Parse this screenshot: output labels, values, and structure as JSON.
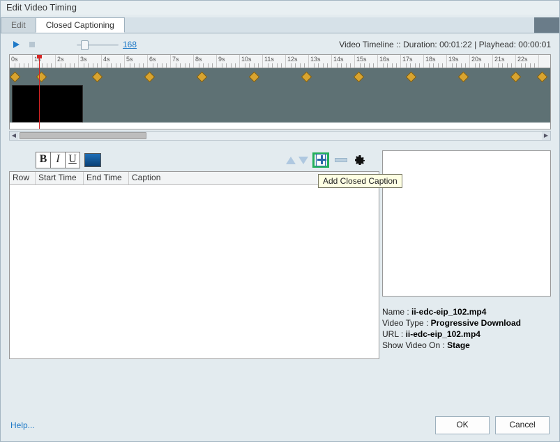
{
  "window": {
    "title": "Edit Video Timing"
  },
  "tabs": {
    "edit": "Edit",
    "cc": "Closed Captioning"
  },
  "controls": {
    "zoom": "168"
  },
  "timeline": {
    "info_prefix": "Video Timeline :: Duration: ",
    "duration": "00:01:22",
    "sep": "  |  Playhead: ",
    "playhead": "00:00:01",
    "tick_labels": [
      "0s",
      "1s",
      "2s",
      "3s",
      "4s",
      "5s",
      "6s",
      "7s",
      "8s",
      "9s",
      "10s",
      "11s",
      "12s",
      "13s",
      "14s",
      "15s",
      "16s",
      "17s",
      "18s",
      "19s",
      "20s",
      "21s",
      "22s"
    ]
  },
  "table": {
    "row": "Row",
    "start": "Start Time",
    "end": "End Time",
    "caption": "Caption"
  },
  "tooltip": "Add Closed Caption",
  "meta": {
    "name_lbl": "Name  :  ",
    "name_val": "ii-edc-eip_102.mp4",
    "type_lbl": "Video Type :   ",
    "type_val": "Progressive Download",
    "url_lbl": "URL :  ",
    "url_val": "ii-edc-eip_102.mp4",
    "show_lbl": "Show Video On : ",
    "show_val": "Stage"
  },
  "footer": {
    "help": "Help...",
    "ok": "OK",
    "cancel": "Cancel"
  }
}
